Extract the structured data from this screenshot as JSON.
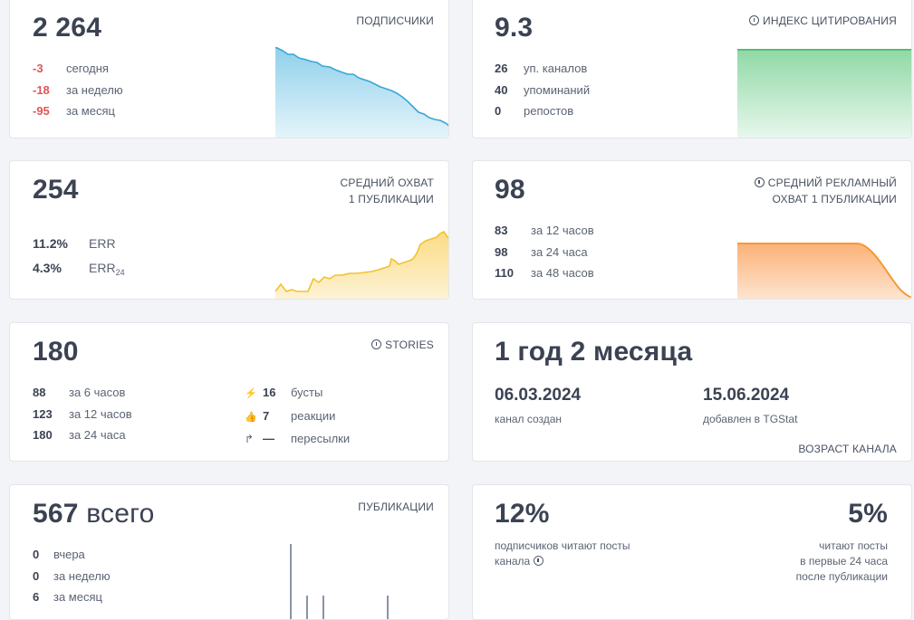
{
  "subscribers": {
    "value": "2 264",
    "caption": "ПОДПИСЧИКИ",
    "rows": [
      {
        "num": "-3",
        "label": "сегодня"
      },
      {
        "num": "-18",
        "label": "за неделю"
      },
      {
        "num": "-95",
        "label": "за месяц"
      }
    ],
    "color": "#3aa6d6"
  },
  "citation": {
    "value": "9.3",
    "caption": "ИНДЕКС ЦИТИРОВАНИЯ",
    "rows": [
      {
        "num": "26",
        "label": "уп. каналов"
      },
      {
        "num": "40",
        "label": "упоминаний"
      },
      {
        "num": "0",
        "label": "репостов"
      }
    ],
    "color": "#4cbb6c"
  },
  "reach": {
    "value": "254",
    "caption_line1": "СРЕДНИЙ ОХВАТ",
    "caption_line2": "1 ПУБЛИКАЦИИ",
    "rows": [
      {
        "num": "11.2%",
        "label": "ERR"
      },
      {
        "num": "4.3%",
        "label": "ERR",
        "sub": "24"
      }
    ],
    "color": "#f2c230"
  },
  "ad_reach": {
    "value": "98",
    "caption_line1": "СРЕДНИЙ РЕКЛАМНЫЙ",
    "caption_line2": "ОХВАТ 1 ПУБЛИКАЦИИ",
    "rows": [
      {
        "num": "83",
        "label": "за 12 часов"
      },
      {
        "num": "98",
        "label": "за 24 часа"
      },
      {
        "num": "110",
        "label": "за 48 часов"
      }
    ],
    "color": "#f7922a"
  },
  "stories": {
    "value": "180",
    "caption": "STORIES",
    "rows_left": [
      {
        "num": "88",
        "label": "за 6 часов"
      },
      {
        "num": "123",
        "label": "за 12 часов"
      },
      {
        "num": "180",
        "label": "за 24 часа"
      }
    ],
    "rows_right": [
      {
        "icon": "⚡",
        "icon_name": "lightning-icon",
        "num": "16",
        "label": "бусты"
      },
      {
        "icon": "👍",
        "icon_name": "thumbs-up-icon",
        "num": "7",
        "label": "реакции"
      },
      {
        "icon": "↱",
        "icon_name": "share-arrow-icon",
        "num": "—",
        "label": "пересылки"
      }
    ]
  },
  "age": {
    "value": "1 год 2 месяца",
    "created_date": "06.03.2024",
    "created_label": "канал создан",
    "added_date": "15.06.2024",
    "added_label": "добавлен в TGStat",
    "caption": "ВОЗРАСТ КАНАЛА"
  },
  "posts": {
    "value_num": "567",
    "value_word": "всего",
    "caption": "ПУБЛИКАЦИИ",
    "rows": [
      {
        "num": "0",
        "label": "вчера"
      },
      {
        "num": "0",
        "label": "за неделю"
      },
      {
        "num": "6",
        "label": "за месяц"
      }
    ]
  },
  "engagement": {
    "left_value": "12%",
    "left_text_line1": "подписчиков читают посты",
    "left_text_line2": "канала",
    "right_value": "5%",
    "right_text_line1": "читают посты",
    "right_text_line2": "в первые 24 часа",
    "right_text_line3": "после публикации"
  }
}
